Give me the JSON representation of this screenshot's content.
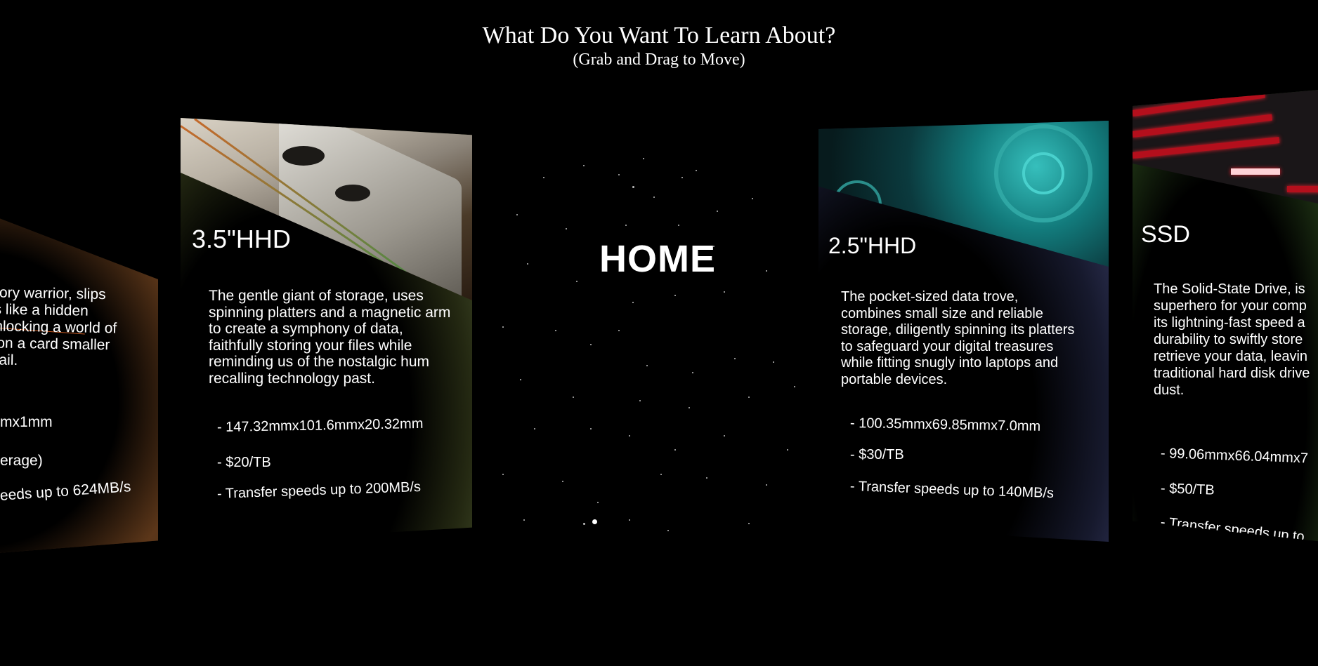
{
  "header": {
    "title": "What Do You Want To Learn About?",
    "subtitle": "(Grab and Drag to Move)"
  },
  "cards": {
    "sd": {
      "description": "emory warrior, slips ces like a hidden , unlocking a world of ity on a card smaller ernail.",
      "specs": [
        "mx1mm",
        "erage)",
        "eeds up to 624MB/s"
      ]
    },
    "hdd35": {
      "title": "3.5\"HHD",
      "description": "The gentle giant of storage, uses spinning platters and a magnetic arm to create a symphony of data, faithfully storing your files while reminding us of the nostalgic hum recalling technology past.",
      "specs": [
        "- 147.32mmx101.6mmx20.32mm",
        "- $20/TB",
        "- Transfer speeds up to 200MB/s"
      ]
    },
    "home": {
      "label": "HOME"
    },
    "hdd25": {
      "title": "2.5\"HHD",
      "description": "The pocket-sized data trove, combines small size and reliable storage, diligently spinning its platters to safeguard your digital treasures while fitting snugly into laptops and portable devices.",
      "specs": [
        "- 100.35mmx69.85mmx7.0mm",
        "- $30/TB",
        "- Transfer speeds up to 140MB/s"
      ]
    },
    "ssd": {
      "title": "SSD",
      "description": "The Solid-State Drive, is superhero for your comp its lightning-fast speed a durability to swiftly store retrieve your data, leavin traditional hard disk drive dust.",
      "specs": [
        "- 99.06mmx66.04mmx7",
        "- $50/TB",
        "- Transfer speeds up to"
      ]
    }
  },
  "colors": {
    "background": "#000000",
    "hdd35_accent": "#5b6a3c",
    "hdd25_accent": "#45497a",
    "ssd_accent": "#3d6a2a",
    "sd_accent": "#c75a22"
  }
}
